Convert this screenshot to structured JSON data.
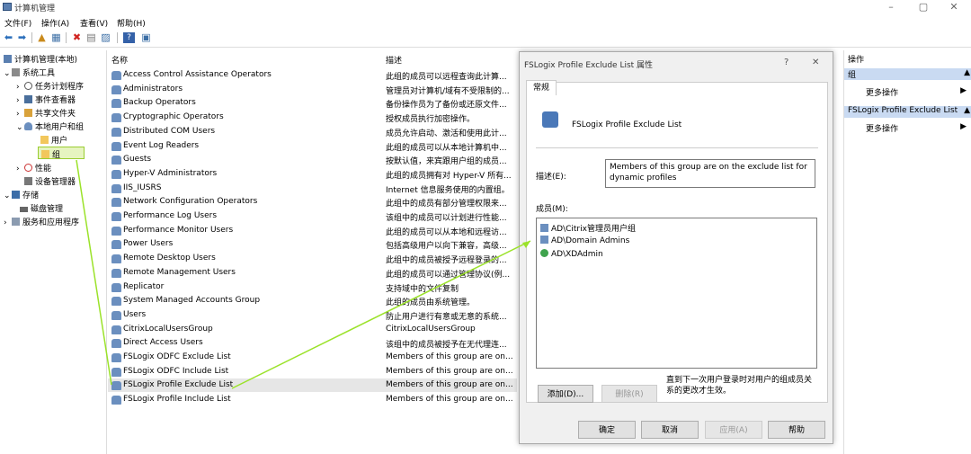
{
  "window": {
    "title": "计算机管理"
  },
  "menu": [
    "文件(F)",
    "操作(A)",
    "查看(V)",
    "帮助(H)"
  ],
  "tree": {
    "root": "计算机管理(本地)",
    "system_tools": "系统工具",
    "task_scheduler": "任务计划程序",
    "event_viewer": "事件查看器",
    "shared_folders": "共享文件夹",
    "local_users": "本地用户和组",
    "users": "用户",
    "groups": "组",
    "performance": "性能",
    "device_manager": "设备管理器",
    "storage": "存储",
    "disk_mgmt": "磁盘管理",
    "services": "服务和应用程序"
  },
  "list": {
    "col_name": "名称",
    "col_desc": "描述",
    "rows": [
      {
        "name": "Access Control Assistance Operators",
        "desc": "此组的成员可以远程查询此计算..."
      },
      {
        "name": "Administrators",
        "desc": "管理员对计算机/域有不受限制的..."
      },
      {
        "name": "Backup Operators",
        "desc": "备份操作员为了备份或还原文件..."
      },
      {
        "name": "Cryptographic Operators",
        "desc": "授权成员执行加密操作。"
      },
      {
        "name": "Distributed COM Users",
        "desc": "成员允许启动、激活和使用此计..."
      },
      {
        "name": "Event Log Readers",
        "desc": "此组的成员可以从本地计算机中..."
      },
      {
        "name": "Guests",
        "desc": "按默认值，来宾跟用户组的成员..."
      },
      {
        "name": "Hyper-V Administrators",
        "desc": "此组的成员拥有对 Hyper-V 所有..."
      },
      {
        "name": "IIS_IUSRS",
        "desc": "Internet 信息服务使用的内置组。"
      },
      {
        "name": "Network Configuration Operators",
        "desc": "此组中的成员有部分管理权限来..."
      },
      {
        "name": "Performance Log Users",
        "desc": "该组中的成员可以计划进行性能..."
      },
      {
        "name": "Performance Monitor Users",
        "desc": "此组的成员可以从本地和远程访..."
      },
      {
        "name": "Power Users",
        "desc": "包括高级用户以向下兼容，高级..."
      },
      {
        "name": "Remote Desktop Users",
        "desc": "此组中的成员被授予远程登录的..."
      },
      {
        "name": "Remote Management Users",
        "desc": "此组的成员可以通过管理协议(例..."
      },
      {
        "name": "Replicator",
        "desc": "支持域中的文件复制"
      },
      {
        "name": "System Managed Accounts Group",
        "desc": "此组的成员由系统管理。"
      },
      {
        "name": "Users",
        "desc": "防止用户进行有意或无意的系统..."
      },
      {
        "name": "CitrixLocalUsersGroup",
        "desc": "CitrixLocalUsersGroup"
      },
      {
        "name": "Direct Access Users",
        "desc": "该组中的成员被授予在无代理连..."
      },
      {
        "name": "FSLogix ODFC Exclude List",
        "desc": "Members of this group are on..."
      },
      {
        "name": "FSLogix ODFC Include List",
        "desc": "Members of this group are on..."
      },
      {
        "name": "FSLogix Profile Exclude List",
        "desc": "Members of this group are on..."
      },
      {
        "name": "FSLogix Profile Include List",
        "desc": "Members of this group are on..."
      }
    ]
  },
  "dialog": {
    "title": "FSLogix Profile Exclude List 属性",
    "help": "?",
    "close": "✕",
    "tab": "常规",
    "group_name": "FSLogix Profile Exclude List",
    "desc_label": "描述(E):",
    "desc_value": "Members of this group are on the exclude list for dynamic profiles",
    "members_label": "成员(M):",
    "members": [
      "AD\\Citrix管理员用户组",
      "AD\\Domain Admins",
      "AD\\XDAdmin"
    ],
    "add": "添加(D)...",
    "remove": "删除(R)",
    "note": "直到下一次用户登录时对用户的组成员关系的更改才生效。",
    "ok": "确定",
    "cancel": "取消",
    "apply": "应用(A)",
    "helpbtn": "帮助"
  },
  "actions": {
    "header": "操作",
    "section1": "组",
    "more1": "更多操作",
    "section2": "FSLogix Profile Exclude List",
    "more2": "更多操作"
  }
}
